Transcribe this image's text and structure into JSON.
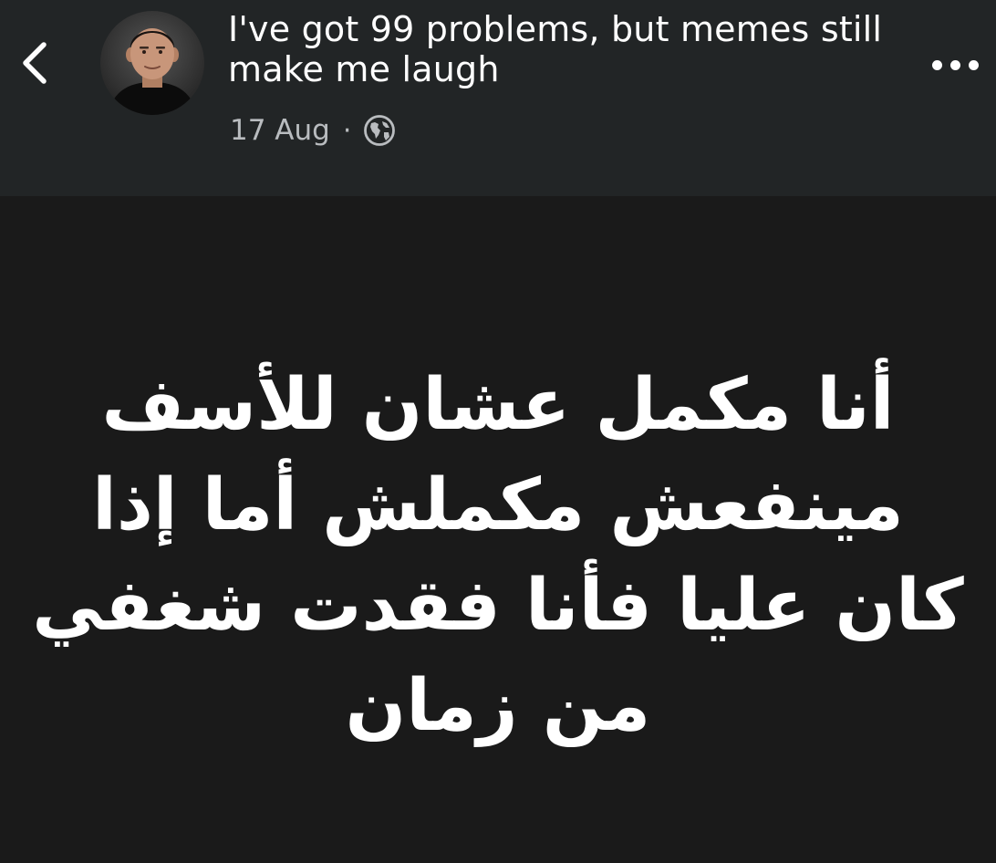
{
  "header": {
    "back_icon": "chevron-left-icon",
    "author_avatar": "avatar",
    "title": "I've got 99 problems, but memes still make me laugh",
    "date": "17 Aug",
    "separator": "·",
    "privacy_icon": "globe-icon",
    "more_icon": "more-horizontal-icon"
  },
  "post": {
    "text": "أنا مكمل عشان للأسف مينفعش مكملش أما إذا كان عليا فأنا فقدت شغفي من زمان"
  },
  "colors": {
    "header_bg": "#222526",
    "body_bg": "#1a1a1a",
    "text_primary": "#ffffff",
    "text_secondary": "#b9bcbf"
  }
}
